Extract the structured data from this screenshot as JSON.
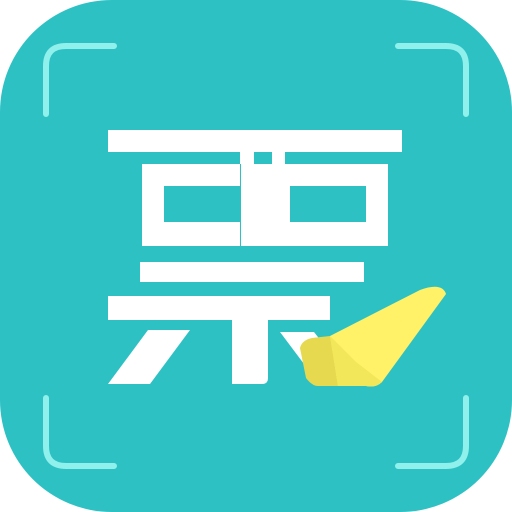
{
  "app_icon": {
    "glyph": "票",
    "icon_name": "ticket-scan-app-icon",
    "colors": {
      "background": "#2EC1C4",
      "corner_brackets": "#8FF0EC",
      "glyph": "#FFFFFF",
      "check_light": "#FFF168",
      "check_dark": "#E6D94F"
    }
  }
}
